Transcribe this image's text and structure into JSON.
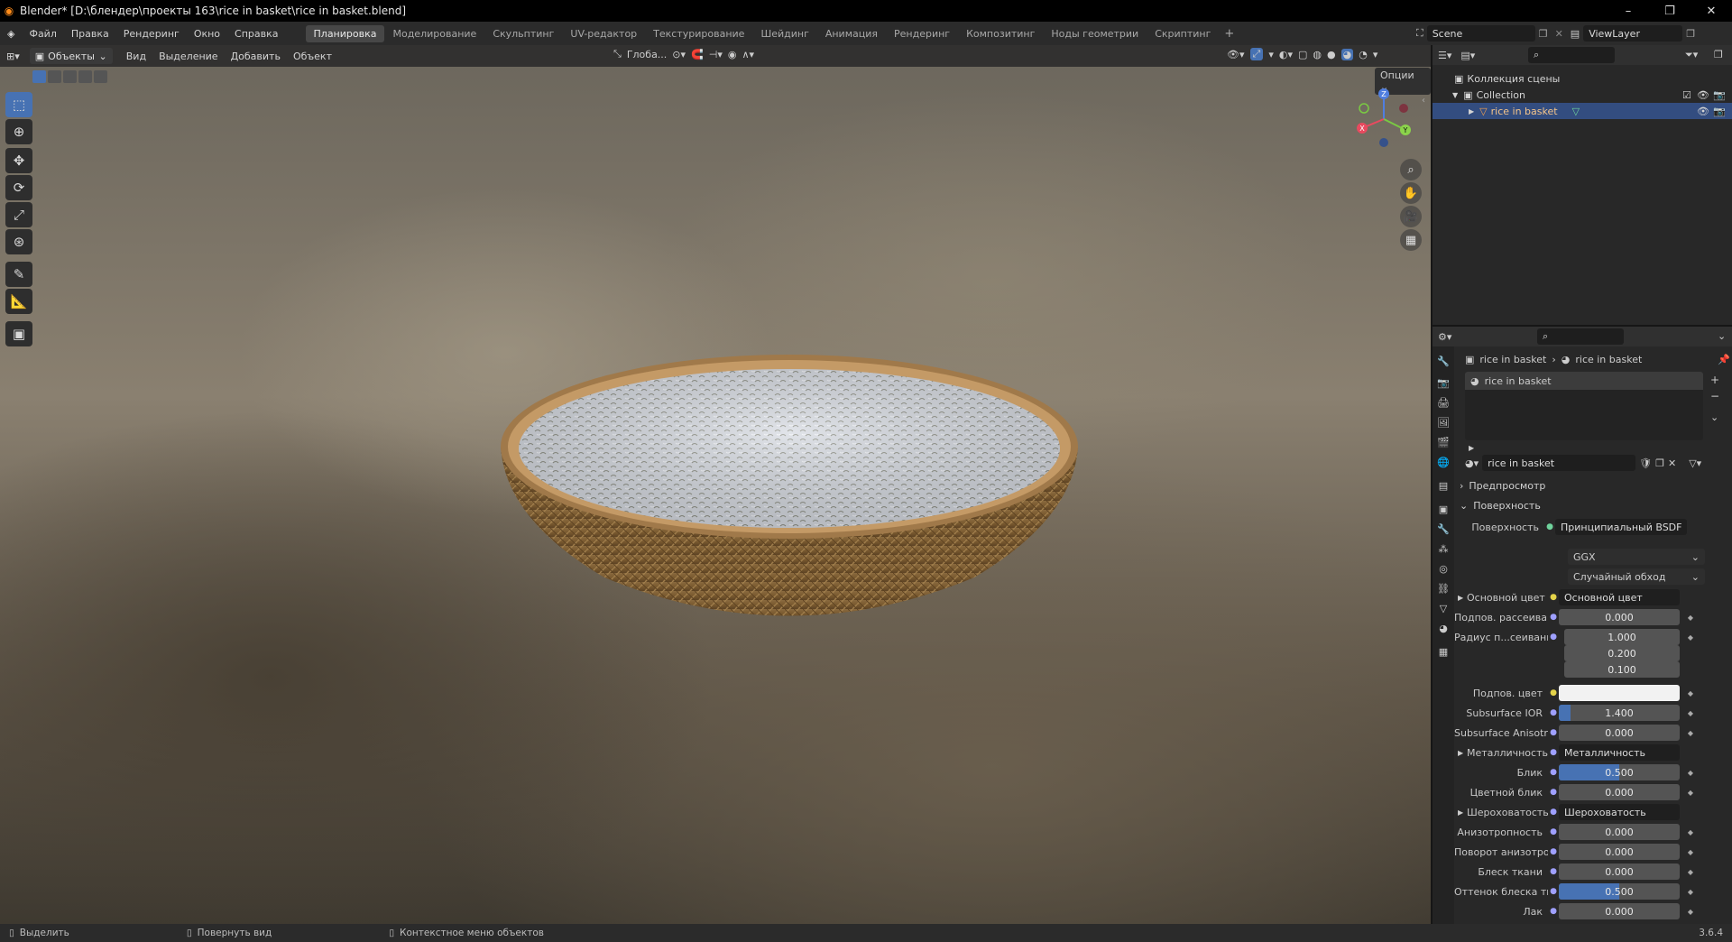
{
  "window": {
    "title": "Blender* [D:\\блендер\\проекты 163\\rice in basket\\rice in basket.blend]",
    "controls": [
      "–",
      "❐",
      "✕"
    ]
  },
  "menu": [
    "Файл",
    "Правка",
    "Рендеринг",
    "Окно",
    "Справка"
  ],
  "workspaces": [
    {
      "label": "Планировка",
      "active": true
    },
    {
      "label": "Моделирование",
      "active": false
    },
    {
      "label": "Скульптинг",
      "active": false
    },
    {
      "label": "UV-редактор",
      "active": false
    },
    {
      "label": "Текстурирование",
      "active": false
    },
    {
      "label": "Шейдинг",
      "active": false
    },
    {
      "label": "Анимация",
      "active": false
    },
    {
      "label": "Рендеринг",
      "active": false
    },
    {
      "label": "Композитинг",
      "active": false
    },
    {
      "label": "Ноды геометрии",
      "active": false
    },
    {
      "label": "Скриптинг",
      "active": false
    }
  ],
  "scene": {
    "name": "Scene",
    "view_layer": "ViewLayer"
  },
  "viewport": {
    "mode": "Объекты",
    "header_menu": [
      "Вид",
      "Выделение",
      "Добавить",
      "Объект"
    ],
    "orientation": "Глоба...",
    "options_label": "Опции",
    "gizmo": {
      "x": "X",
      "y": "Y",
      "z": "Z"
    }
  },
  "outliner": {
    "scene_collection": "Коллекция сцены",
    "collection": "Collection",
    "object": "rice in basket"
  },
  "properties": {
    "breadcrumb_object": "rice in basket",
    "breadcrumb_material": "rice in basket",
    "slot_name": "rice in basket",
    "material_name": "rice in basket",
    "panel_preview": "Предпросмотр",
    "panel_surface": "Поверхность",
    "surface_label": "Поверхность",
    "surface_value": "Принципиальный BSDF",
    "distribution": "GGX",
    "subsurface_method": "Случайный обход",
    "rows": [
      {
        "label": "Основной цвет",
        "socket": "Основной цвет",
        "expand": true
      },
      {
        "label": "Подпов. рассеива...",
        "value": "0.000",
        "fill": 0
      },
      {
        "label": "Радиус п...сеивания",
        "value": "1.000",
        "fill": 0
      },
      {
        "label": "",
        "value": "0.200",
        "fill": 0
      },
      {
        "label": "",
        "value": "0.100",
        "fill": 0
      },
      {
        "label": "Подпов. цвет",
        "color": "#f2f2f2"
      },
      {
        "label": "Subsurface IOR",
        "value": "1.400",
        "fill": 0.1
      },
      {
        "label": "Subsurface Anisotr...",
        "value": "0.000",
        "fill": 0
      },
      {
        "label": "Металличность",
        "socket": "Металличность",
        "expand": true
      },
      {
        "label": "Блик",
        "value": "0.500",
        "fill": 0.5
      },
      {
        "label": "Цветной блик",
        "value": "0.000",
        "fill": 0
      },
      {
        "label": "Шероховатость",
        "socket": "Шероховатость",
        "expand": true
      },
      {
        "label": "Анизотропность",
        "value": "0.000",
        "fill": 0
      },
      {
        "label": "Поворот анизотро...",
        "value": "0.000",
        "fill": 0
      },
      {
        "label": "Блеск ткани",
        "value": "0.000",
        "fill": 0
      },
      {
        "label": "Оттенок блеска тк...",
        "value": "0.500",
        "fill": 0.5
      },
      {
        "label": "Лак",
        "value": "0.000",
        "fill": 0
      }
    ]
  },
  "status": {
    "left": "Выделить",
    "middle": "Повернуть вид",
    "right": "Контекстное меню объектов",
    "version": "3.6.4"
  },
  "colors": {
    "accent": "#4772b3",
    "selection": "#334d80",
    "background": "#1d1d1d",
    "blender_logo": "#ff8c1a"
  }
}
